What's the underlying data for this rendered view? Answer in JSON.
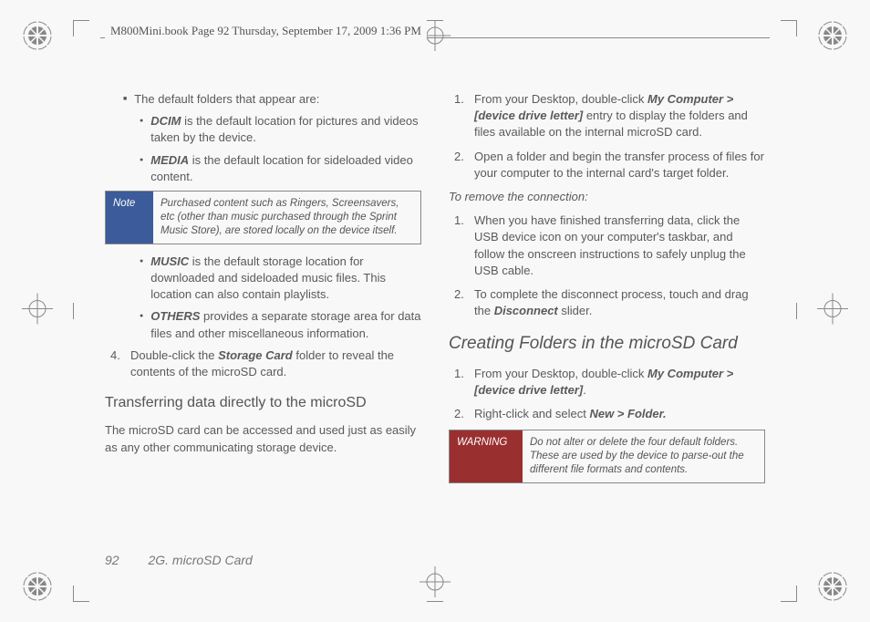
{
  "header": "M800Mini.book  Page 92  Thursday, September 17, 2009  1:36 PM",
  "left": {
    "intro": "The default folders that appear are:",
    "dcim_label": "DCIM",
    "dcim_text": " is the default location for pictures and videos taken by the device.",
    "media_label": "MEDIA",
    "media_text": " is the default location for sideloaded video content.",
    "note_label": "Note",
    "note_text": "Purchased content such as Ringers, Screensavers, etc (other than music purchased through the Sprint Music Store), are stored locally on the device itself.",
    "music_label": "MUSIC",
    "music_text": " is the default storage location for downloaded and sideloaded music files. This location can also contain playlists.",
    "others_label": "OTHERS",
    "others_text": " provides a separate storage area for data files and other miscellaneous information.",
    "step4_num": "4.",
    "step4_a": "Double-click the ",
    "step4_b": "Storage Card",
    "step4_c": " folder to reveal the contents of the microSD card.",
    "h_sub": "Transferring data directly to the microSD",
    "para": "The microSD card can be accessed and used just as easily as any other communicating storage device."
  },
  "right": {
    "s1_num": "1.",
    "s1_a": "From your Desktop, double-click ",
    "s1_b": "My Computer > [device drive letter]",
    "s1_c": " entry to display the folders and files available on the internal microSD card.",
    "s2_num": "2.",
    "s2": "Open a folder and begin the transfer process of files for your computer to the internal card's target folder.",
    "remove_h": "To remove the connection:",
    "r1_num": "1.",
    "r1": "When you have finished transferring data, click the USB device icon on your computer's taskbar, and follow the onscreen instructions to safely unplug the USB cable.",
    "r2_num": "2.",
    "r2_a": "To complete the disconnect process, touch and drag the ",
    "r2_b": "Disconnect",
    "r2_c": " slider.",
    "h_main": "Creating Folders in the microSD Card",
    "c1_num": "1.",
    "c1_a": "From your Desktop, double-click ",
    "c1_b": "My Computer > [device drive letter]",
    "c1_c": ".",
    "c2_num": "2.",
    "c2_a": "Right-click and select ",
    "c2_b": "New > Folder.",
    "warn_label": "WARNING",
    "warn_text": "Do not alter or delete the four default folders. These are used by the device to parse-out the different file formats and contents."
  },
  "footer": {
    "page_num": "92",
    "section": "2G. microSD Card"
  }
}
